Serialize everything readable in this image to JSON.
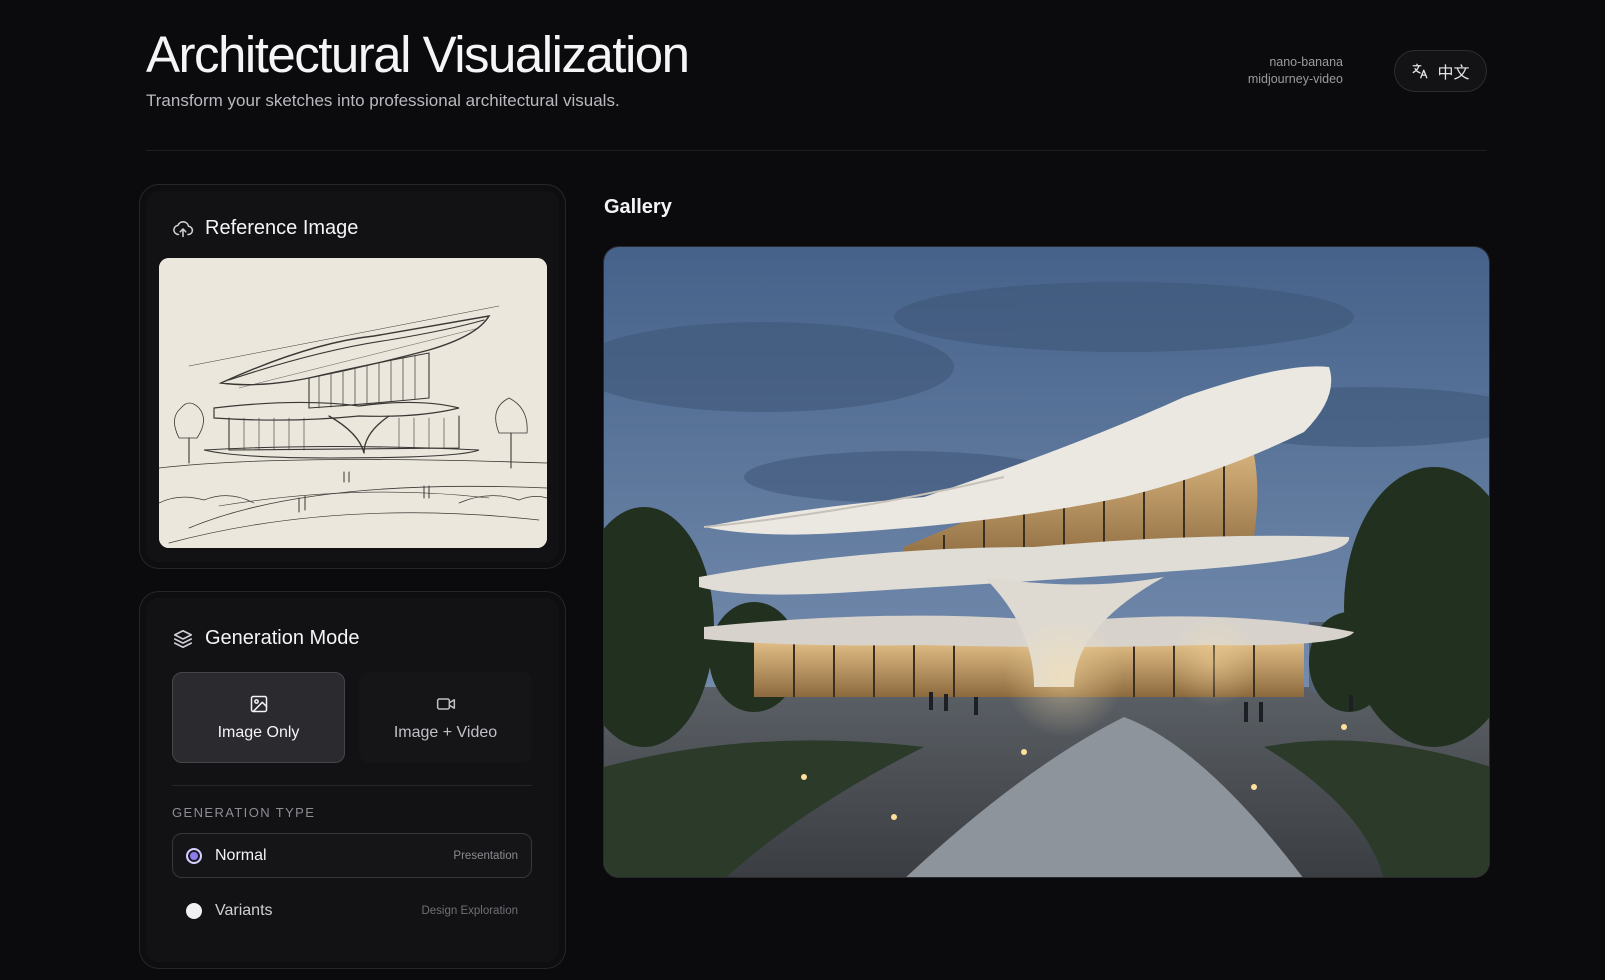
{
  "header": {
    "title": "Architectural Visualization",
    "subtitle": "Transform your sketches into professional architectural visuals.",
    "models": [
      "nano-banana",
      "midjourney-video"
    ],
    "language_button": "中文"
  },
  "reference": {
    "heading": "Reference Image"
  },
  "generation_mode": {
    "heading": "Generation Mode",
    "modes": [
      {
        "label": "Image Only",
        "icon": "image-icon",
        "selected": true
      },
      {
        "label": "Image + Video",
        "icon": "video-camera-icon",
        "selected": false
      }
    ],
    "type_label": "GENERATION TYPE",
    "types": [
      {
        "label": "Normal",
        "tag": "Presentation",
        "selected": true
      },
      {
        "label": "Variants",
        "tag": "Design Exploration",
        "selected": false
      }
    ]
  },
  "gallery": {
    "heading": "Gallery"
  },
  "colors": {
    "background": "#0b0b0d",
    "panel": "#121215",
    "accent_radio": "#8b7cf0",
    "sketch_paper": "#ebe7dd",
    "dusk_sky": "#5d7597"
  },
  "icons": [
    "language-icon",
    "upload-cloud-icon",
    "layers-icon",
    "image-icon",
    "video-camera-icon"
  ]
}
